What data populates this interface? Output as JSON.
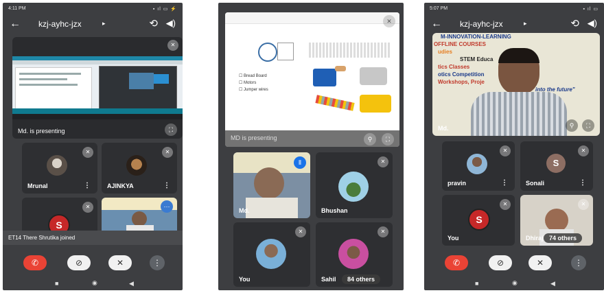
{
  "phone1": {
    "status_time": "4:11 PM",
    "status_right": "▪ ıl ▭ ⚡",
    "meeting_code": "kzj-ayhc-jzx",
    "presenting_label": "Md. is presenting",
    "tiles": [
      {
        "name": "Mrunal"
      },
      {
        "name": "AJINKYA"
      },
      {
        "name": ""
      },
      {
        "name": ""
      }
    ],
    "letter_avatar": "S",
    "toast": "ET14 There Shrutika joined"
  },
  "phone2": {
    "shared_items": [
      "Bread Board",
      "Motors",
      "Jumper wires"
    ],
    "presenting_overlay": "MD is presenting",
    "tiles": [
      {
        "name": "Md."
      },
      {
        "name": "Bhushan"
      },
      {
        "name": "You"
      },
      {
        "name": "Sahil"
      }
    ],
    "others_count": "84 others"
  },
  "phone3": {
    "status_time": "5:07 PM",
    "status_right": "▪ ıl ▭",
    "meeting_code": "kzj-ayhc-jzx",
    "main_speaker": "Md.",
    "banner_lines": [
      "M-INNOVATION-LEARNING",
      "OFFLINE COURSES",
      "udies",
      "STEM Educa",
      "tics Classes",
      "otics Competition",
      "Workshops, Proje",
      "into the future\""
    ],
    "tiles": [
      {
        "name": "pravin"
      },
      {
        "name": "Sonali"
      },
      {
        "name": "You"
      },
      {
        "name": "Dhiraj"
      }
    ],
    "letter_avatar_sonali": "S",
    "letter_avatar_you": "S",
    "others_count": "74 others"
  },
  "colors": {
    "end_call": "#ea4335",
    "tile": "#2e2f32",
    "bg": "#3d3e41"
  }
}
